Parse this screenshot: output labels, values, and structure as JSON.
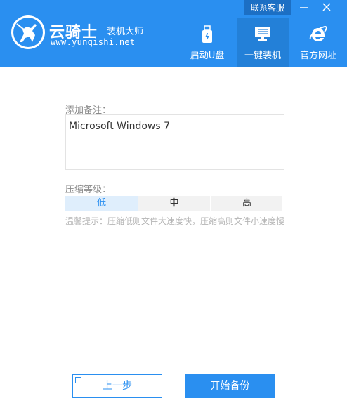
{
  "app": {
    "brand_name": "云骑士",
    "brand_sub": "装机大师",
    "brand_url": "www.yunqishi.net",
    "contact_label": "联系客服"
  },
  "nav": {
    "usb": "启动U盘",
    "install": "一键装机",
    "web": "官方网址",
    "active": "install"
  },
  "form": {
    "note_label": "添加备注：",
    "note_value": "Microsoft Windows 7",
    "level_label": "压缩等级：",
    "levels": [
      "低",
      "中",
      "高"
    ],
    "selected_level": "低",
    "hint": "温馨提示：压缩低则文件大速度快，压缩高则文件小速度慢"
  },
  "buttons": {
    "prev": "上一步",
    "start": "开始备份"
  },
  "colors": {
    "primary": "#2a8ff0",
    "nav_active": "#2380d8",
    "contact_bg": "#1c6fc4",
    "selected_bg": "#dfeefc"
  },
  "icons": [
    "knight-logo-icon",
    "minimize-icon",
    "close-icon",
    "usb-icon",
    "monitor-icon",
    "ie-icon"
  ]
}
